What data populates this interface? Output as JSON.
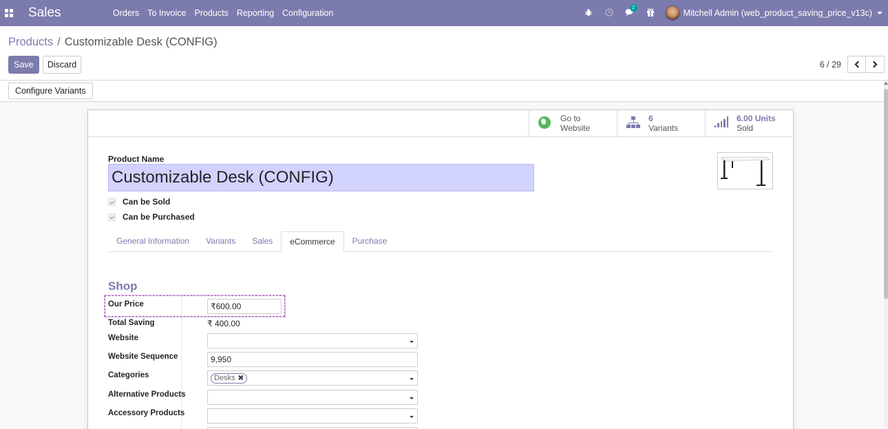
{
  "navbar": {
    "app_name": "Sales",
    "menu": [
      "Orders",
      "To Invoice",
      "Products",
      "Reporting",
      "Configuration"
    ],
    "chat_badge": "2",
    "user_name": "Mitchell Admin (web_product_saving_price_v13c)",
    "background_color": "#7c7bad"
  },
  "breadcrumb": {
    "parent": "Products",
    "separator": "/",
    "current": "Customizable Desk (CONFIG)"
  },
  "toolbar": {
    "save_label": "Save",
    "discard_label": "Discard",
    "pager_value": "6 / 29"
  },
  "header": {
    "configure_variants_label": "Configure Variants"
  },
  "smart_buttons": {
    "website": {
      "line1": "Go to",
      "line2": "Website"
    },
    "variants": {
      "count": "6",
      "label": "Variants"
    },
    "sold": {
      "count": "6.00 Units",
      "label": "Sold"
    }
  },
  "form": {
    "product_name_label": "Product Name",
    "product_name_value": "Customizable Desk (CONFIG)",
    "can_be_sold_label": "Can be Sold",
    "can_be_purchased_label": "Can be Purchased",
    "can_be_sold": true,
    "can_be_purchased": true
  },
  "tabs": [
    "General Information",
    "Variants",
    "Sales",
    "eCommerce",
    "Purchase"
  ],
  "active_tab": "eCommerce",
  "shop": {
    "title": "Shop",
    "our_price_label": "Our Price",
    "our_price_value": "₹600.00",
    "total_saving_label": "Total Saving",
    "total_saving_value": "₹ 400.00",
    "website_label": "Website",
    "website_value": "",
    "website_sequence_label": "Website Sequence",
    "website_sequence_value": "9,950",
    "categories_label": "Categories",
    "categories_tags": [
      "Desks"
    ],
    "alternative_products_label": "Alternative Products",
    "alternative_products_value": "",
    "accessory_products_label": "Accessory Products",
    "accessory_products_value": ""
  },
  "colors": {
    "accent": "#7c7bad",
    "name_field_bg": "#d2d2ff",
    "website_icon": "#56b65e"
  }
}
